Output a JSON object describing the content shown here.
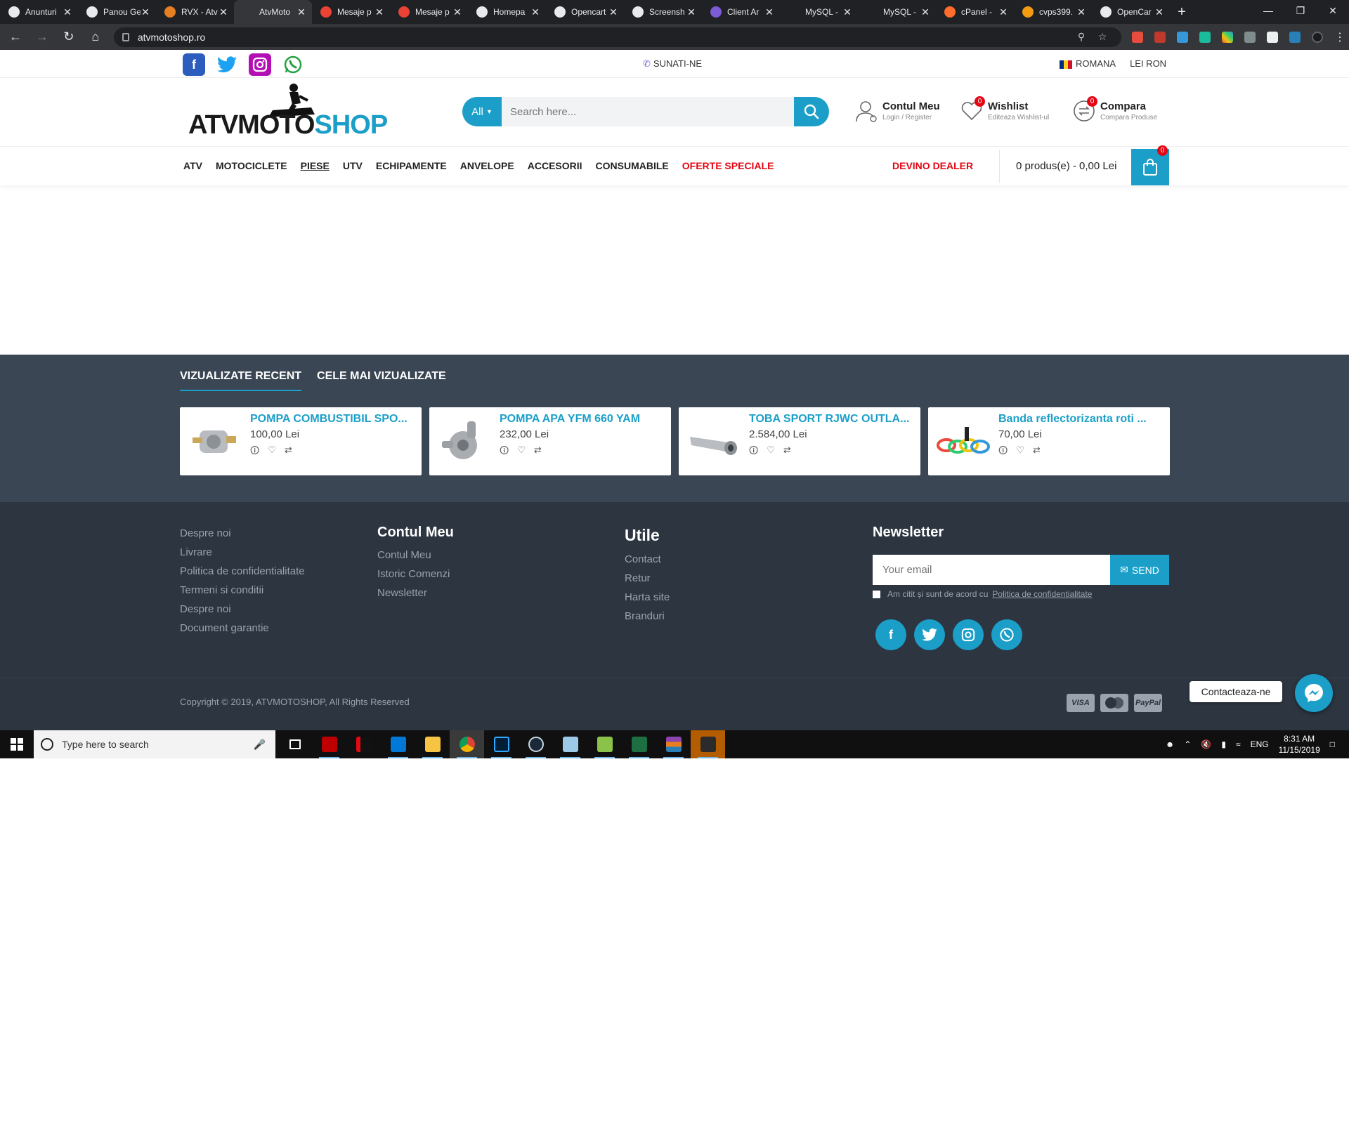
{
  "browser": {
    "tabs": [
      {
        "title": "Anunturi",
        "fav": "olx"
      },
      {
        "title": "Panou Ge",
        "fav": "globe"
      },
      {
        "title": "RVX - Atv",
        "fav": "pinwheel"
      },
      {
        "title": "AtvMoto",
        "fav": "atv",
        "active": true
      },
      {
        "title": "Mesaje p",
        "fav": "gmail"
      },
      {
        "title": "Mesaje p",
        "fav": "gmail"
      },
      {
        "title": "Homepa",
        "fav": "globe"
      },
      {
        "title": "Opencart",
        "fav": "globe"
      },
      {
        "title": "Screensh",
        "fav": "globe"
      },
      {
        "title": "Client Ar",
        "fav": "client"
      },
      {
        "title": "MySQL -",
        "fav": "none"
      },
      {
        "title": "MySQL -",
        "fav": "none"
      },
      {
        "title": "cPanel -",
        "fav": "cpanel"
      },
      {
        "title": "cvps399.",
        "fav": "cvps"
      },
      {
        "title": "OpenCar",
        "fav": "globe"
      }
    ],
    "new_tab": "+",
    "url": "atvmotoshop.ro"
  },
  "topbar": {
    "phone": "SUNATI-NE",
    "language": "ROMANA",
    "currency": "LEI RON"
  },
  "header": {
    "logo_part1": "ATVMOTO",
    "logo_part2": "SHOP",
    "search_category": "All",
    "search_placeholder": "Search here...",
    "account": {
      "title": "Contul Meu",
      "sub": "Login / Register"
    },
    "wishlist": {
      "title": "Wishlist",
      "sub": "Editeaza Wishlist-ul",
      "count": "0"
    },
    "compare": {
      "title": "Compara",
      "sub": "Compara Produse",
      "count": "0"
    }
  },
  "menu": {
    "items": [
      "ATV",
      "MOTOCICLETE",
      "PIESE",
      "UTV",
      "ECHIPAMENTE",
      "ANVELOPE",
      "ACCESORII",
      "CONSUMABILE",
      "OFERTE SPECIALE"
    ],
    "dealer": "DEVINO DEALER",
    "cart_text": "0 produs(e) - 0,00 Lei",
    "cart_count": "0"
  },
  "recent": {
    "tabs": [
      "VIZUALIZATE RECENT",
      "CELE MAI VIZUALIZATE"
    ],
    "products": [
      {
        "name": "POMPA COMBUSTIBIL SPO...",
        "price": "100,00 Lei"
      },
      {
        "name": "POMPA APA YFM 660 YAM",
        "price": "232,00 Lei"
      },
      {
        "name": "TOBA SPORT RJWC OUTLA...",
        "price": "2.584,00 Lei"
      },
      {
        "name": "Banda reflectorizanta roti ...",
        "price": "70,00 Lei"
      }
    ]
  },
  "footer": {
    "col1": [
      "Despre noi",
      "Livrare",
      "Politica de confidentialitate",
      "Termeni si conditii",
      "Despre noi",
      "Document garantie"
    ],
    "col2_title": "Contul Meu",
    "col2": [
      "Contul Meu",
      "Istoric Comenzi",
      "Newsletter"
    ],
    "col3_title": "Utile",
    "col3": [
      "Contact",
      "Retur",
      "Harta site",
      "Branduri"
    ],
    "newsletter_title": "Newsletter",
    "email_placeholder": "Your email",
    "send": "SEND",
    "agree_text": "Am citit și sunt de acord cu",
    "agree_link": "Politica de confidentialitate",
    "copyright": "Copyright © 2019, ATVMOTOSHOP, All Rights Reserved",
    "payments": [
      "VISA",
      "MC",
      "PayPal"
    ]
  },
  "chat": {
    "label": "Contacteaza-ne"
  },
  "taskbar": {
    "search_placeholder": "Type here to search",
    "language": "ENG",
    "time": "8:31 AM",
    "date": "11/15/2019"
  }
}
